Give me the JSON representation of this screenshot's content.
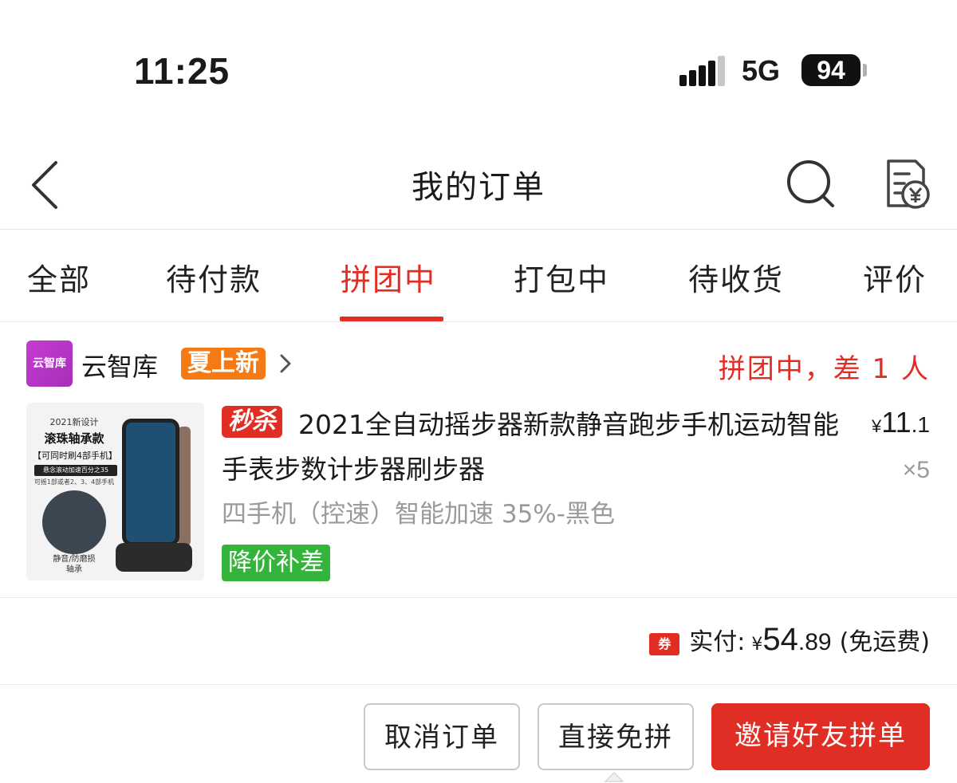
{
  "status_bar": {
    "time": "11:25",
    "network": "5G",
    "battery": "94"
  },
  "nav": {
    "title": "我的订单",
    "back_icon": "chevron-left-icon",
    "search_icon": "search-icon",
    "bill_icon": "yen-bill-icon"
  },
  "tabs": [
    {
      "label": "全部",
      "active": false
    },
    {
      "label": "待付款",
      "active": false
    },
    {
      "label": "拼团中",
      "active": true
    },
    {
      "label": "打包中",
      "active": false
    },
    {
      "label": "待收货",
      "active": false
    },
    {
      "label": "评价",
      "active": false
    }
  ],
  "order": {
    "shop": {
      "logo_text": "云智库",
      "name": "云智库",
      "tag": "夏上新"
    },
    "status": "拼团中，差 1 人",
    "thumbnail": {
      "line1": "2021新设计",
      "line2": "滚珠轴承款",
      "line3": "【可同时刷4部手机】",
      "line4": "悬念滚动加速百分之35",
      "line5": "可摇1部或者2、3、4部手机",
      "line6": "静音/防磨损\n轴承"
    },
    "product": {
      "flash_tag": "秒杀",
      "title": "2021全自动摇步器新款静音跑步手机运动智能手表步数计步器刷步器",
      "sku": "四手机（控速）智能加速 35%-黑色",
      "price_symbol": "¥",
      "price_int": "11",
      "price_dec": ".1",
      "quantity": "×5",
      "promo_tag": "降价补差"
    },
    "total": {
      "coupon_icon_text": "券",
      "label": "实付:",
      "symbol": "¥",
      "amount_int": "54",
      "amount_dec": ".89",
      "note": "(免运费)"
    }
  },
  "actions": {
    "cancel": "取消订单",
    "direct": "直接免拼",
    "invite": "邀请好友拼单"
  },
  "colors": {
    "accent": "#e02e24",
    "orange_tag": "#f57a14",
    "green_tag": "#35b43b",
    "muted_text": "#9a9a9a"
  }
}
